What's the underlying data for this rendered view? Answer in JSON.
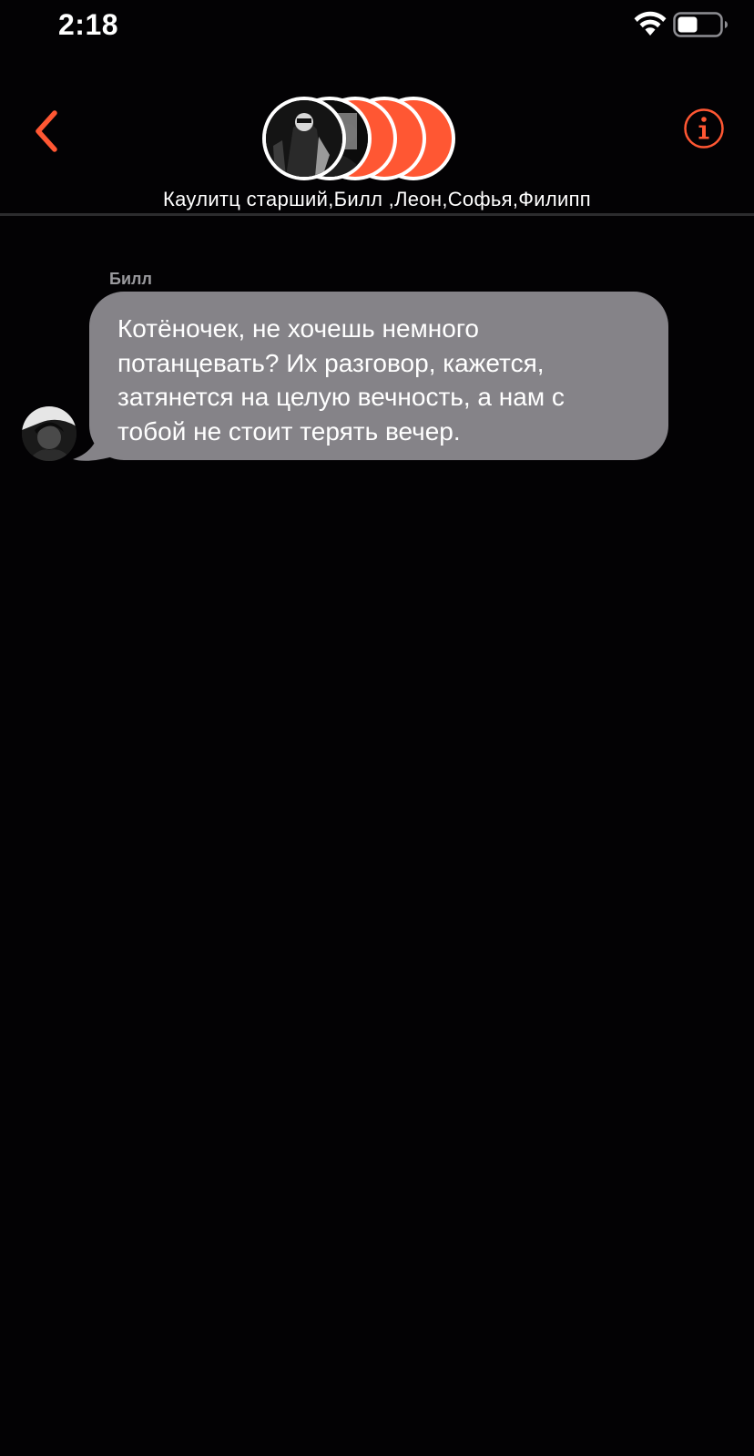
{
  "status_bar": {
    "time": "2:18",
    "icons": [
      "wifi-icon",
      "battery-icon"
    ]
  },
  "header": {
    "back_icon": "chevron-left-icon",
    "info_icon": "info-circle-icon",
    "participants_label": "Каулитц старший,Билл ,Леон,Софья,Филипп",
    "accent_color": "#ff5733"
  },
  "messages": [
    {
      "sender": "Билл",
      "text": "Котёночек, не хочешь немного потанцевать? Их разговор, кажется, затянется на целую вечность, а нам с тобой не стоит терять вечер.",
      "lines": [
        "Котёночек, не хочешь немного",
        "потанцевать? Их разговор, кажется,",
        "затянется на целую вечность, а нам с",
        "тобой не стоит терять вечер."
      ],
      "bubble_color": "#858388"
    }
  ],
  "colors": {
    "background": "#030204",
    "accent": "#ff5733",
    "divider": "#2c2c2e",
    "sender_name": "#9a9a9e"
  }
}
